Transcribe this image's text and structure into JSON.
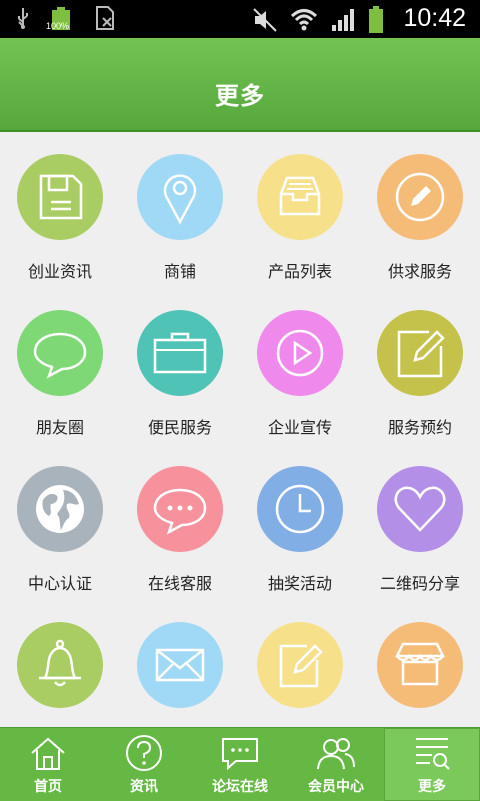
{
  "status_bar": {
    "time": "10:42",
    "battery_percent": "100%",
    "left_icons": [
      "usb-icon",
      "battery-full-icon",
      "sim-card-icon"
    ],
    "right_icons": [
      "mute-icon",
      "wifi-icon",
      "signal-icon",
      "battery-icon"
    ]
  },
  "header": {
    "title": "更多"
  },
  "grid": {
    "items": [
      {
        "label": "创业资讯",
        "icon": "floppy-disk-icon",
        "color": "#a9cd62"
      },
      {
        "label": "商铺",
        "icon": "location-pin-icon",
        "color": "#9fd9f5"
      },
      {
        "label": "产品列表",
        "icon": "inbox-tray-icon",
        "color": "#f7e08a"
      },
      {
        "label": "供求服务",
        "icon": "pencil-circle-icon",
        "color": "#f5bc78"
      },
      {
        "label": "朋友圈",
        "icon": "chat-bubble-icon",
        "color": "#7fd876"
      },
      {
        "label": "便民服务",
        "icon": "briefcase-icon",
        "color": "#4fc3b6"
      },
      {
        "label": "企业宣传",
        "icon": "play-icon",
        "color": "#ef89ec"
      },
      {
        "label": "服务预约",
        "icon": "edit-note-icon",
        "color": "#c4c24a"
      },
      {
        "label": "中心认证",
        "icon": "globe-icon",
        "color": "#a9b3bb"
      },
      {
        "label": "在线客服",
        "icon": "message-dots-icon",
        "color": "#f7919b"
      },
      {
        "label": "抽奖活动",
        "icon": "clock-icon",
        "color": "#81aee4"
      },
      {
        "label": "二维码分享",
        "icon": "heart-icon",
        "color": "#b38fe8"
      },
      {
        "label": "",
        "icon": "bell-icon",
        "color": "#a9cd62"
      },
      {
        "label": "",
        "icon": "envelope-icon",
        "color": "#9fd9f5"
      },
      {
        "label": "",
        "icon": "note-pencil-icon",
        "color": "#f7e08a"
      },
      {
        "label": "",
        "icon": "shop-icon",
        "color": "#f5bc78"
      }
    ]
  },
  "tabbar": {
    "tabs": [
      {
        "label": "首页",
        "icon": "home-icon"
      },
      {
        "label": "资讯",
        "icon": "question-circle-icon"
      },
      {
        "label": "论坛在线",
        "icon": "chat-dots-icon"
      },
      {
        "label": "会员中心",
        "icon": "members-icon"
      },
      {
        "label": "更多",
        "icon": "list-search-icon",
        "active": true
      }
    ]
  },
  "colors": {
    "header_green": "#62b346",
    "tabbar_green": "#66b844",
    "background": "#efefef"
  }
}
